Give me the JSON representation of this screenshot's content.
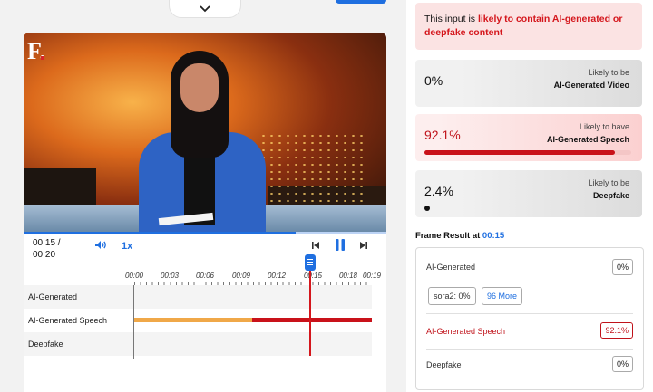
{
  "player": {
    "logo": "F.",
    "time_current": "00:15 /",
    "time_total": "00:20",
    "speed": "1x",
    "progress_fraction": 0.75
  },
  "timeline": {
    "ticks": [
      "00:00",
      "00:03",
      "00:06",
      "00:09",
      "00:12",
      "00:15",
      "00:18",
      "00:19"
    ],
    "tracks": [
      {
        "label": "AI-Generated"
      },
      {
        "label": "AI-Generated Speech"
      },
      {
        "label": "Deepfake"
      }
    ],
    "colors": {
      "orange": "#f0a848",
      "red": "#c9121a"
    }
  },
  "alert": {
    "prefix": "This input is ",
    "emphasis": "likely to contain AI-generated or deepfake content"
  },
  "cards": [
    {
      "percent": "0%",
      "label_top": "Likely to be",
      "label_bottom": "AI-Generated Video",
      "fill": 0
    },
    {
      "percent": "92.1%",
      "label_top": "Likely to have",
      "label_bottom": "AI-Generated Speech",
      "fill": 0.921
    },
    {
      "percent": "2.4%",
      "label_top": "Likely to be",
      "label_bottom": "Deepfake",
      "fill": 0.024
    }
  ],
  "frame": {
    "title_prefix": "Frame Result at ",
    "time": "00:15",
    "rows": [
      {
        "label": "AI-Generated",
        "value": "0%"
      },
      {
        "label": "AI-Generated Speech",
        "value": "92.1%"
      },
      {
        "label": "Deepfake",
        "value": "0%"
      }
    ],
    "chips": [
      "sora2: 0%",
      "96 More"
    ]
  },
  "colors": {
    "accent": "#1f6fe0",
    "alert": "#d4161c",
    "alert_bg": "#fbe3e3"
  }
}
